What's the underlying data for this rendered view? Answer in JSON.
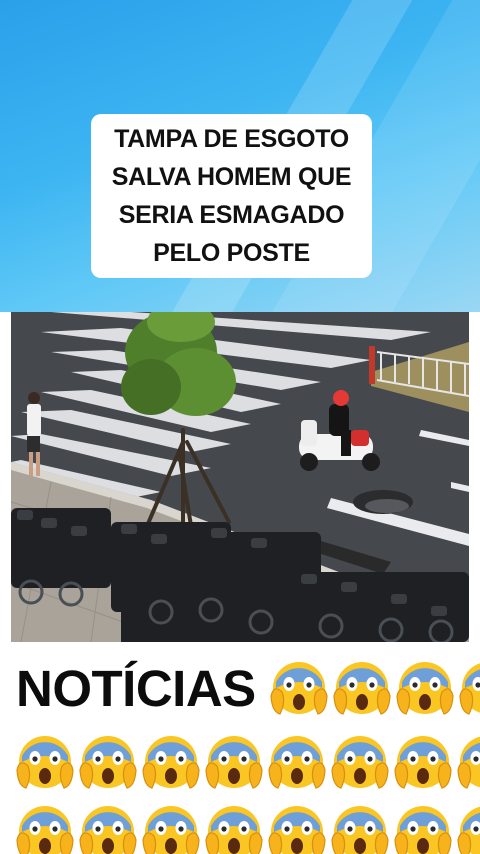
{
  "banner": {
    "title_lines": [
      "TAMPA DE ESGOTO",
      "SALVA HOMEM QUE",
      "SERIA ESMAGADO",
      "PELO POSTE"
    ],
    "background_color": "#3db5f2"
  },
  "video": {
    "scene": "street-crosswalk-motorbike"
  },
  "headline": {
    "text": "NOTÍCIAS"
  },
  "emoji": {
    "name": "face-screaming-in-fear-icon",
    "headline_row_count": 4,
    "row_counts": [
      8,
      8
    ]
  }
}
